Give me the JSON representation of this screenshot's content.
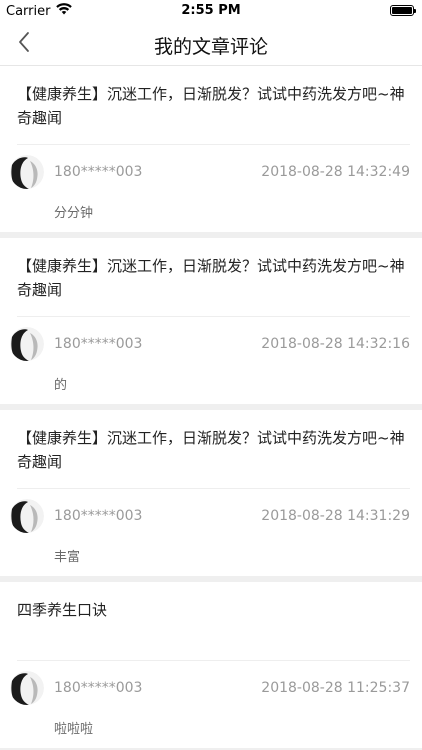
{
  "status_bar": {
    "carrier": "Carrier",
    "time": "2:55 PM",
    "battery_level": 1.0
  },
  "nav": {
    "title": "我的文章评论",
    "back_icon": "chevron-left-icon"
  },
  "comments": [
    {
      "article_title": "【健康养生】沉迷工作，日渐脱发？试试中药洗发方吧~神奇趣闻",
      "user": "180*****003",
      "time": "2018-08-28 14:32:49",
      "text": "分分钟"
    },
    {
      "article_title": "【健康养生】沉迷工作，日渐脱发？试试中药洗发方吧~神奇趣闻",
      "user": "180*****003",
      "time": "2018-08-28 14:32:16",
      "text": "的"
    },
    {
      "article_title": "【健康养生】沉迷工作，日渐脱发？试试中药洗发方吧~神奇趣闻",
      "user": "180*****003",
      "time": "2018-08-28 14:31:29",
      "text": "丰富"
    },
    {
      "article_title": "四季养生口诀",
      "user": "180*****003",
      "time": "2018-08-28 11:25:37",
      "text": "啦啦啦"
    }
  ]
}
